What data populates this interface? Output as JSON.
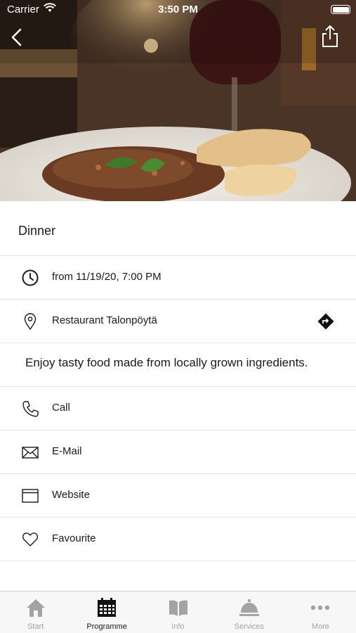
{
  "status_bar": {
    "carrier": "Carrier",
    "time": "3:50 PM"
  },
  "event": {
    "title": "Dinner",
    "datetime": "from 11/19/20, 7:00 PM",
    "location": "Restaurant Talonpöytä",
    "description": "Enjoy tasty food made from locally grown ingredients."
  },
  "actions": {
    "call": "Call",
    "email": "E-Mail",
    "website": "Website",
    "favourite": "Favourite"
  },
  "tabs": [
    {
      "label": "Start",
      "icon": "home-icon",
      "active": false
    },
    {
      "label": "Programme",
      "icon": "calendar-icon",
      "active": true
    },
    {
      "label": "Info",
      "icon": "book-icon",
      "active": false
    },
    {
      "label": "Services",
      "icon": "bell-icon",
      "active": false
    },
    {
      "label": "More",
      "icon": "more-icon",
      "active": false
    }
  ],
  "colors": {
    "text": "#1a1a1a",
    "divider": "#e4e4e4",
    "tab_inactive": "#a3a3a3",
    "tab_bar_bg": "#f7f7f7"
  }
}
